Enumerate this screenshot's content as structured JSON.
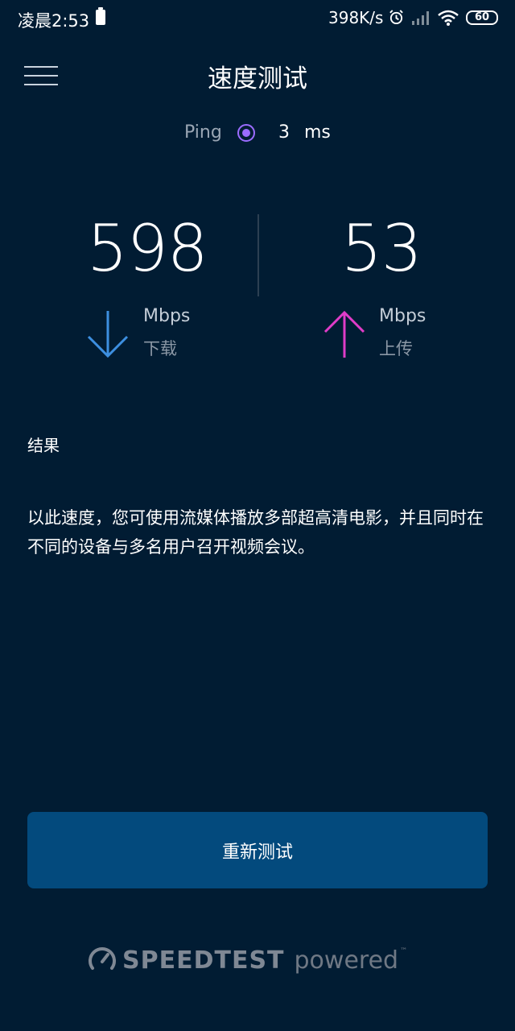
{
  "status_bar": {
    "time": "凌晨2:53",
    "net_speed": "398K/s",
    "battery_level": "60"
  },
  "header": {
    "title": "速度测试"
  },
  "ping": {
    "label": "Ping",
    "value": "3",
    "unit": "ms",
    "icon_color": "#9b6cff"
  },
  "download": {
    "value": "598",
    "unit": "Mbps",
    "label": "下载",
    "arrow_color": "#3d8fe0"
  },
  "upload": {
    "value": "53",
    "unit": "Mbps",
    "label": "上传",
    "arrow_color": "#e03cc8"
  },
  "result": {
    "heading": "结果",
    "description": "以此速度，您可使用流媒体播放多部超高清电影，并且同时在不同的设备与多名用户召开视频会议。"
  },
  "actions": {
    "retest_label": "重新测试"
  },
  "footer": {
    "brand": "SPEEDTEST",
    "powered": "powered",
    "trademark": "™"
  },
  "colors": {
    "background": "#011c33",
    "button": "#034a7d"
  }
}
